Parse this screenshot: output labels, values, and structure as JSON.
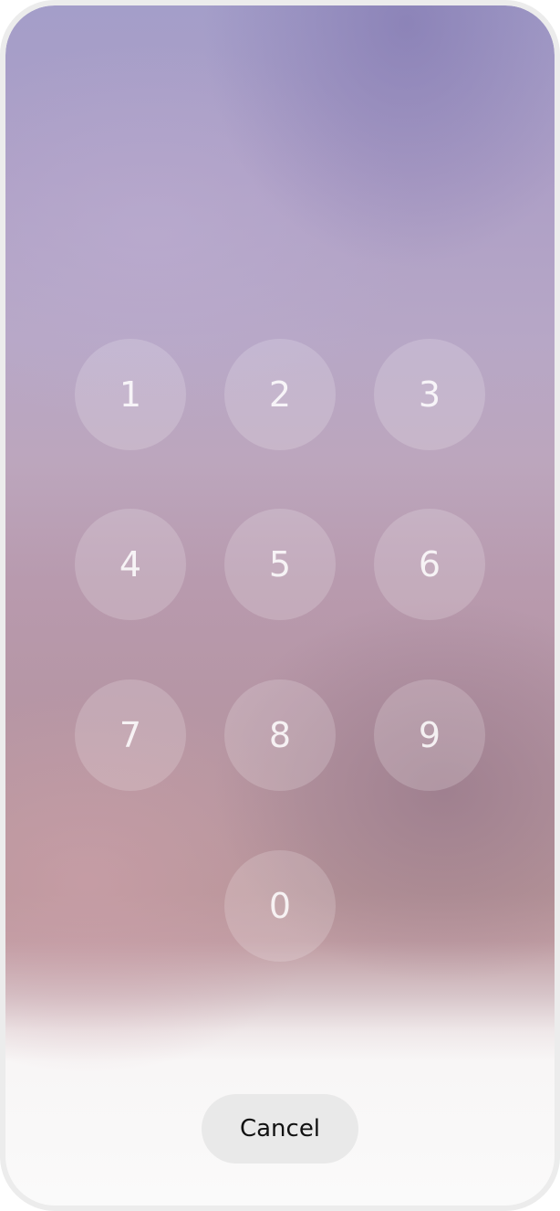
{
  "keypad": {
    "keys": [
      "1",
      "2",
      "3",
      "4",
      "5",
      "6",
      "7",
      "8",
      "9",
      "0"
    ]
  },
  "cancel": {
    "label": "Cancel"
  }
}
